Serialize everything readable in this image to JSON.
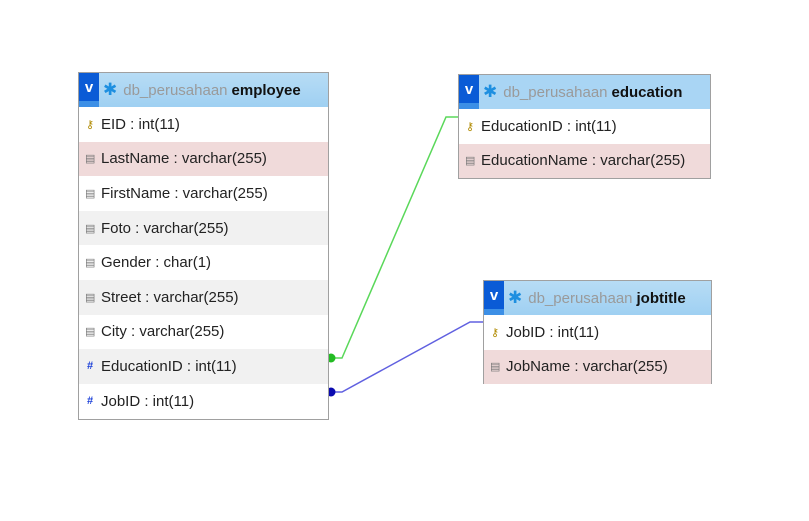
{
  "db": "db_perusahaan",
  "colors": {
    "fk_education": "#5ad85a",
    "fk_jobtitle": "#6060e0",
    "header": "#a9d5f4",
    "selected_header": "#fde99a",
    "row_pink": "#f0dada",
    "row_grey": "#f1f1f1"
  },
  "tables": {
    "employee": {
      "name": "employee",
      "toggle": "v",
      "rows": [
        {
          "text": "EID : int(11)",
          "icon": "key-icon"
        },
        {
          "text": "LastName : varchar(255)",
          "icon": "column-icon"
        },
        {
          "text": "FirstName : varchar(255)",
          "icon": "column-icon"
        },
        {
          "text": "Foto : varchar(255)",
          "icon": "column-icon"
        },
        {
          "text": "Gender : char(1)",
          "icon": "column-icon"
        },
        {
          "text": "Street : varchar(255)",
          "icon": "column-icon"
        },
        {
          "text": "City : varchar(255)",
          "icon": "column-icon"
        },
        {
          "text": "EducationID : int(11)",
          "icon": "hash-icon"
        },
        {
          "text": "JobID : int(11)",
          "icon": "hash-icon"
        }
      ]
    },
    "education": {
      "name": "education",
      "toggle": "v",
      "rows": [
        {
          "text": "EducationID : int(11)",
          "icon": "key-icon"
        },
        {
          "text": "EducationName : varchar(255)",
          "icon": "column-icon"
        }
      ]
    },
    "jobtitle": {
      "name": "jobtitle",
      "toggle": "v",
      "rows": [
        {
          "text": "JobID : int(11)",
          "icon": "key-icon"
        },
        {
          "text": "JobName : varchar(255)",
          "icon": "column-icon"
        }
      ]
    }
  }
}
